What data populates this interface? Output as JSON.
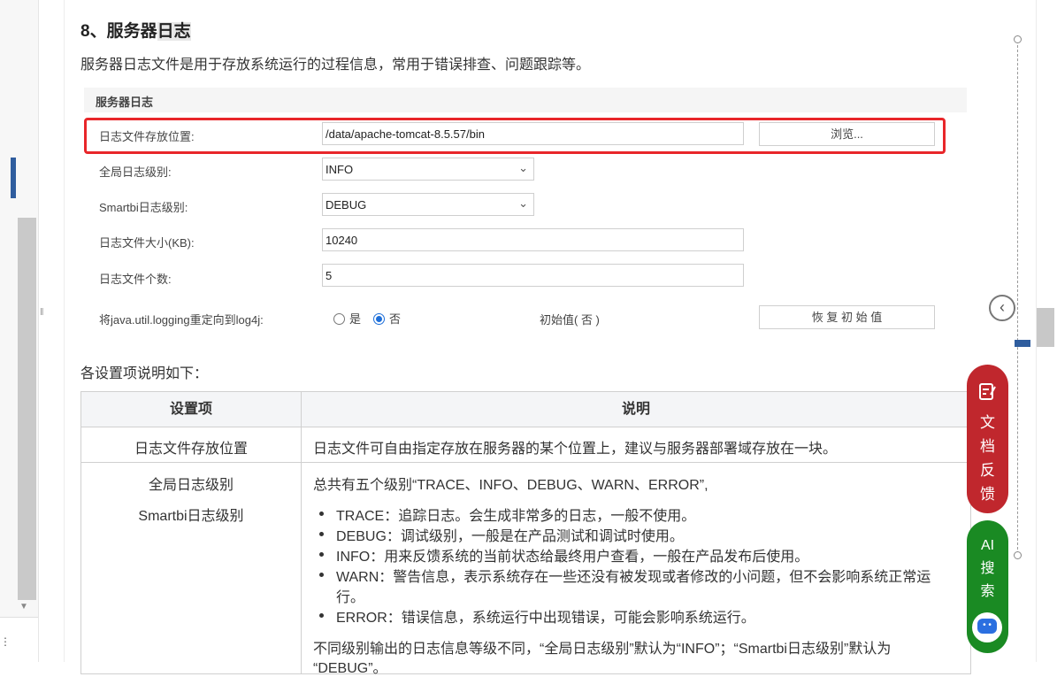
{
  "section": {
    "title_prefix": "8、服务器",
    "title_highlight": "日志",
    "description": "服务器日志文件是用于存放系统运行的过程信息，常用于错误排查、问题跟踪等。"
  },
  "panel": {
    "header": "服务器日志",
    "fields": [
      {
        "label": "日志文件存放位置:",
        "value": "/data/apache-tomcat-8.5.57/bin"
      },
      {
        "label": "全局日志级别:",
        "value": "INFO"
      },
      {
        "label": "Smartbi日志级别:",
        "value": "DEBUG"
      },
      {
        "label": "日志文件大小(KB):",
        "value": "10240"
      },
      {
        "label": "日志文件个数:",
        "value": "5"
      },
      {
        "label": "将java.util.logging重定向到log4j:",
        "value": ""
      }
    ],
    "browse_label": "浏览...",
    "radio_yes": "是",
    "radio_no": "否",
    "initial_value_label": "初始值( 否 )",
    "restore_label": "恢 复 初 始 值"
  },
  "intro": "各设置项说明如下：",
  "table": {
    "headers": [
      "设置项",
      "说明"
    ],
    "row1": {
      "item": "日志文件存放位置",
      "desc": "日志文件可自由指定存放在服务器的某个位置上，建议与服务器部署域存放在一块。"
    },
    "row2": {
      "item1": "全局日志级别",
      "item2": "Smartbi日志级别",
      "summary": "总共有五个级别“TRACE、INFO、DEBUG、WARN、ERROR”,",
      "bullets": [
        "TRACE：追踪日志。会生成非常多的日志，一般不使用。",
        "DEBUG：调试级别，一般是在产品测试和调试时使用。",
        "INFO：用来反馈系统的当前状态给最终用户查看，一般在产品发布后使用。",
        "WARN：警告信息，表示系统存在一些还没有被发现或者修改的小问题，但不会影响系统正常运",
        "行。",
        "ERROR：错误信息，系统运行中出现错误，可能会影响系统运行。"
      ],
      "note_line1": "不同级别输出的日志信息等级不同，“全局日志级别”默认为“INFO”；“Smartbi日志级别”默认为",
      "note_line2": "“DEBUG”。"
    }
  },
  "floating": {
    "feedback_label": [
      "文",
      "档",
      "反",
      "馈"
    ],
    "ai_label": [
      "AI",
      "搜",
      "索"
    ],
    "feedback_color": "#c0272d",
    "ai_color": "#1a8a23"
  }
}
